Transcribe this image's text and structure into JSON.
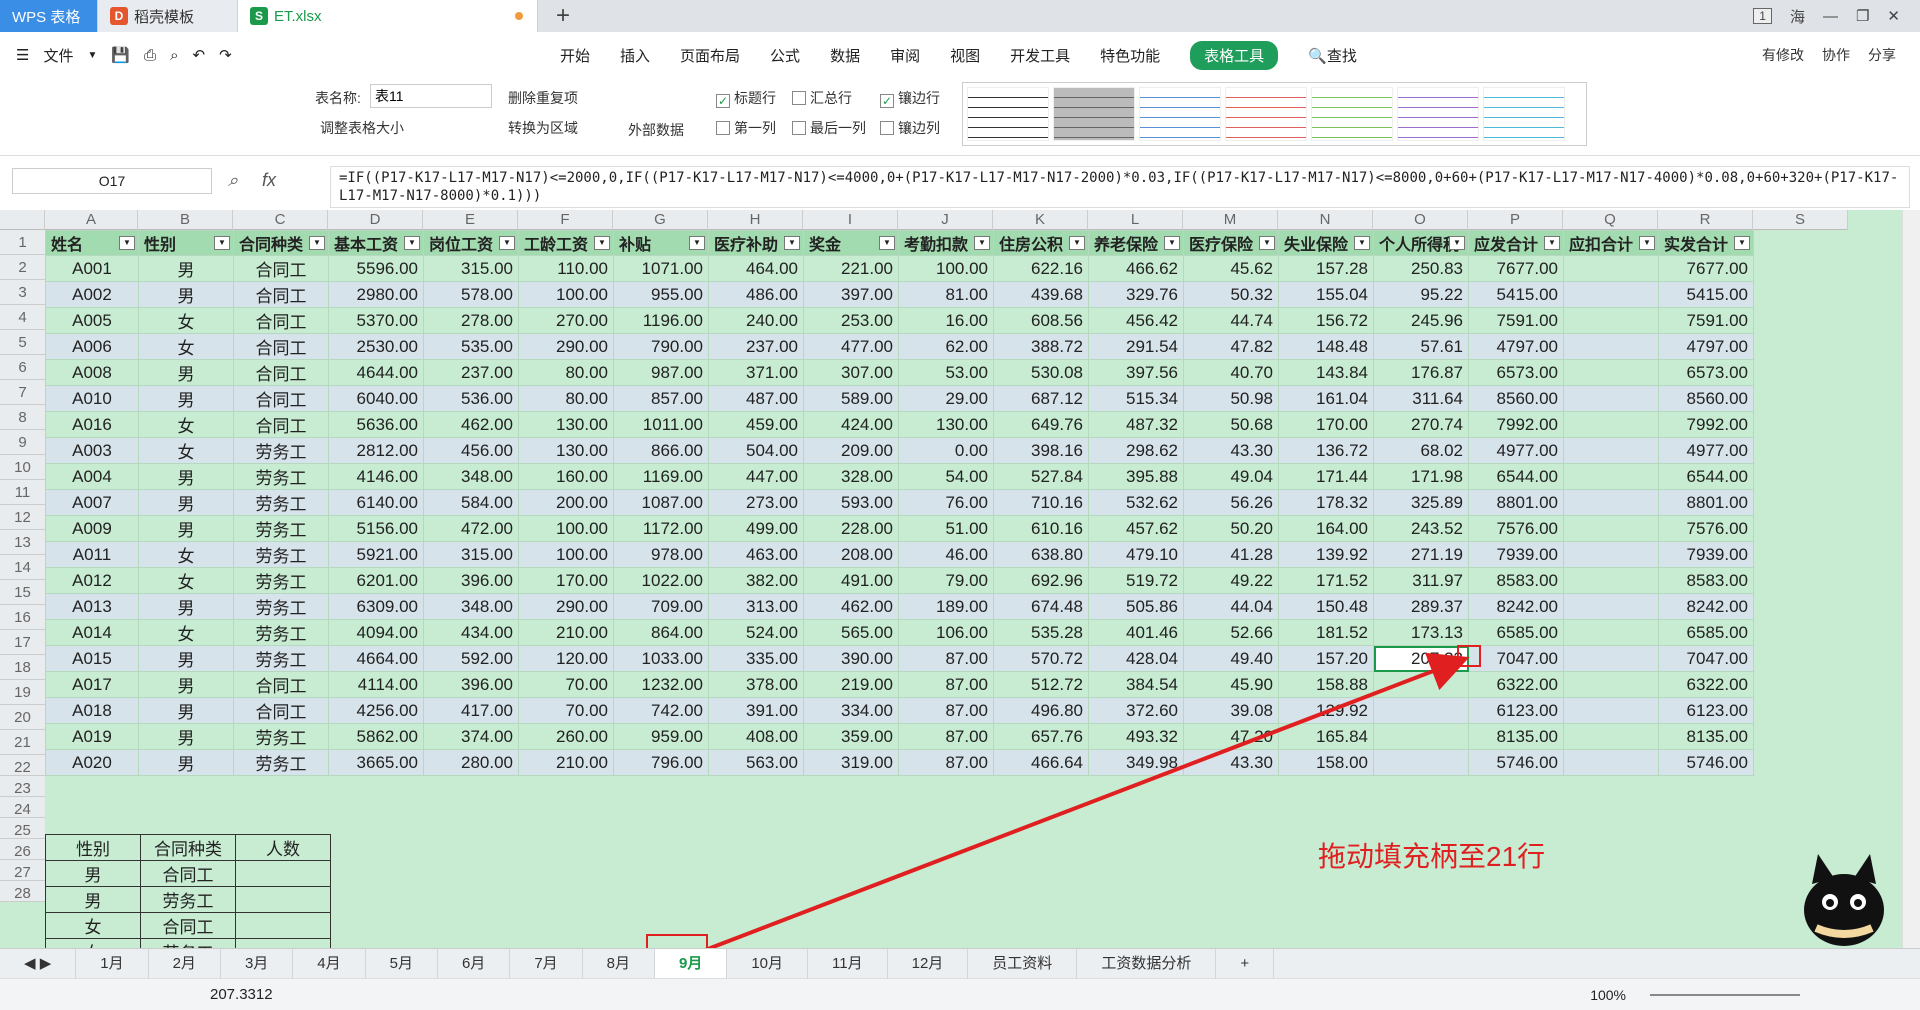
{
  "titlebar": {
    "tabs": [
      {
        "label": "WPS 表格"
      },
      {
        "label": "稻壳模板"
      },
      {
        "label": "ET.xlsx"
      }
    ],
    "badge": "1",
    "user": "海"
  },
  "menu": {
    "file": "文件",
    "items": [
      "开始",
      "插入",
      "页面布局",
      "公式",
      "数据",
      "审阅",
      "视图",
      "开发工具",
      "特色功能",
      "表格工具"
    ],
    "search": "查找",
    "right": [
      "有修改",
      "协作",
      "分享"
    ]
  },
  "toolbar": {
    "table_name_label": "表名称:",
    "table_name": "表11",
    "resize": "调整表格大小",
    "remove_dup": "删除重复项",
    "to_range": "转换为区域",
    "external": "外部数据",
    "checks": [
      {
        "label": "标题行",
        "checked": true
      },
      {
        "label": "汇总行",
        "checked": false
      },
      {
        "label": "镶边行",
        "checked": true
      },
      {
        "label": "第一列",
        "checked": false
      },
      {
        "label": "最后一列",
        "checked": false
      },
      {
        "label": "镶边列",
        "checked": false
      }
    ]
  },
  "formula": {
    "cell": "O17",
    "fx": "fx",
    "text": "=IF((P17-K17-L17-M17-N17)<=2000,0,IF((P17-K17-L17-M17-N17)<=4000,0+(P17-K17-L17-M17-N17-2000)*0.03,IF((P17-K17-L17-M17-N17)<=8000,0+60+(P17-K17-L17-M17-N17-4000)*0.08,0+60+320+(P17-K17-L17-M17-N17-8000)*0.1)))"
  },
  "columns": [
    "A",
    "B",
    "C",
    "D",
    "E",
    "F",
    "G",
    "H",
    "I",
    "J",
    "K",
    "L",
    "M",
    "N",
    "O",
    "P",
    "Q",
    "R",
    "S"
  ],
  "headers": [
    "姓名",
    "性别",
    "合同种类",
    "基本工资",
    "岗位工资",
    "工龄工资",
    "补贴",
    "医疗补助",
    "奖金",
    "考勤扣款",
    "住房公积",
    "养老保险",
    "医疗保险",
    "失业保险",
    "个人所得税",
    "应发合计",
    "应扣合计",
    "实发合计"
  ],
  "rows": [
    [
      "A001",
      "男",
      "合同工",
      "5596.00",
      "315.00",
      "110.00",
      "1071.00",
      "464.00",
      "221.00",
      "100.00",
      "622.16",
      "466.62",
      "45.62",
      "157.28",
      "250.83",
      "7677.00",
      "",
      "7677.00"
    ],
    [
      "A002",
      "男",
      "合同工",
      "2980.00",
      "578.00",
      "100.00",
      "955.00",
      "486.00",
      "397.00",
      "81.00",
      "439.68",
      "329.76",
      "50.32",
      "155.04",
      "95.22",
      "5415.00",
      "",
      "5415.00"
    ],
    [
      "A005",
      "女",
      "合同工",
      "5370.00",
      "278.00",
      "270.00",
      "1196.00",
      "240.00",
      "253.00",
      "16.00",
      "608.56",
      "456.42",
      "44.74",
      "156.72",
      "245.96",
      "7591.00",
      "",
      "7591.00"
    ],
    [
      "A006",
      "女",
      "合同工",
      "2530.00",
      "535.00",
      "290.00",
      "790.00",
      "237.00",
      "477.00",
      "62.00",
      "388.72",
      "291.54",
      "47.82",
      "148.48",
      "57.61",
      "4797.00",
      "",
      "4797.00"
    ],
    [
      "A008",
      "男",
      "合同工",
      "4644.00",
      "237.00",
      "80.00",
      "987.00",
      "371.00",
      "307.00",
      "53.00",
      "530.08",
      "397.56",
      "40.70",
      "143.84",
      "176.87",
      "6573.00",
      "",
      "6573.00"
    ],
    [
      "A010",
      "男",
      "合同工",
      "6040.00",
      "536.00",
      "80.00",
      "857.00",
      "487.00",
      "589.00",
      "29.00",
      "687.12",
      "515.34",
      "50.98",
      "161.04",
      "311.64",
      "8560.00",
      "",
      "8560.00"
    ],
    [
      "A016",
      "女",
      "合同工",
      "5636.00",
      "462.00",
      "130.00",
      "1011.00",
      "459.00",
      "424.00",
      "130.00",
      "649.76",
      "487.32",
      "50.68",
      "170.00",
      "270.74",
      "7992.00",
      "",
      "7992.00"
    ],
    [
      "A003",
      "女",
      "劳务工",
      "2812.00",
      "456.00",
      "130.00",
      "866.00",
      "504.00",
      "209.00",
      "0.00",
      "398.16",
      "298.62",
      "43.30",
      "136.72",
      "68.02",
      "4977.00",
      "",
      "4977.00"
    ],
    [
      "A004",
      "男",
      "劳务工",
      "4146.00",
      "348.00",
      "160.00",
      "1169.00",
      "447.00",
      "328.00",
      "54.00",
      "527.84",
      "395.88",
      "49.04",
      "171.44",
      "171.98",
      "6544.00",
      "",
      "6544.00"
    ],
    [
      "A007",
      "男",
      "劳务工",
      "6140.00",
      "584.00",
      "200.00",
      "1087.00",
      "273.00",
      "593.00",
      "76.00",
      "710.16",
      "532.62",
      "56.26",
      "178.32",
      "325.89",
      "8801.00",
      "",
      "8801.00"
    ],
    [
      "A009",
      "男",
      "劳务工",
      "5156.00",
      "472.00",
      "100.00",
      "1172.00",
      "499.00",
      "228.00",
      "51.00",
      "610.16",
      "457.62",
      "50.20",
      "164.00",
      "243.52",
      "7576.00",
      "",
      "7576.00"
    ],
    [
      "A011",
      "女",
      "劳务工",
      "5921.00",
      "315.00",
      "100.00",
      "978.00",
      "463.00",
      "208.00",
      "46.00",
      "638.80",
      "479.10",
      "41.28",
      "139.92",
      "271.19",
      "7939.00",
      "",
      "7939.00"
    ],
    [
      "A012",
      "女",
      "劳务工",
      "6201.00",
      "396.00",
      "170.00",
      "1022.00",
      "382.00",
      "491.00",
      "79.00",
      "692.96",
      "519.72",
      "49.22",
      "171.52",
      "311.97",
      "8583.00",
      "",
      "8583.00"
    ],
    [
      "A013",
      "男",
      "劳务工",
      "6309.00",
      "348.00",
      "290.00",
      "709.00",
      "313.00",
      "462.00",
      "189.00",
      "674.48",
      "505.86",
      "44.04",
      "150.48",
      "289.37",
      "8242.00",
      "",
      "8242.00"
    ],
    [
      "A014",
      "女",
      "劳务工",
      "4094.00",
      "434.00",
      "210.00",
      "864.00",
      "524.00",
      "565.00",
      "106.00",
      "535.28",
      "401.46",
      "52.66",
      "181.52",
      "173.13",
      "6585.00",
      "",
      "6585.00"
    ],
    [
      "A015",
      "男",
      "劳务工",
      "4664.00",
      "592.00",
      "120.00",
      "1033.00",
      "335.00",
      "390.00",
      "87.00",
      "570.72",
      "428.04",
      "49.40",
      "157.20",
      "207.33",
      "7047.00",
      "",
      "7047.00"
    ],
    [
      "A017",
      "男",
      "合同工",
      "4114.00",
      "396.00",
      "70.00",
      "1232.00",
      "378.00",
      "219.00",
      "87.00",
      "512.72",
      "384.54",
      "45.90",
      "158.88",
      "",
      "6322.00",
      "",
      "6322.00"
    ],
    [
      "A018",
      "男",
      "合同工",
      "4256.00",
      "417.00",
      "70.00",
      "742.00",
      "391.00",
      "334.00",
      "87.00",
      "496.80",
      "372.60",
      "39.08",
      "129.92",
      "",
      "6123.00",
      "",
      "6123.00"
    ],
    [
      "A019",
      "男",
      "劳务工",
      "5862.00",
      "374.00",
      "260.00",
      "959.00",
      "408.00",
      "359.00",
      "87.00",
      "657.76",
      "493.32",
      "47.20",
      "165.84",
      "",
      "8135.00",
      "",
      "8135.00"
    ],
    [
      "A020",
      "男",
      "劳务工",
      "3665.00",
      "280.00",
      "210.00",
      "796.00",
      "563.00",
      "319.00",
      "87.00",
      "466.64",
      "349.98",
      "43.30",
      "158.00",
      "",
      "5746.00",
      "",
      "5746.00"
    ]
  ],
  "summary": {
    "headers": [
      "性别",
      "合同种类",
      "人数"
    ],
    "rows": [
      [
        "男",
        "合同工",
        ""
      ],
      [
        "男",
        "劳务工",
        ""
      ],
      [
        "女",
        "合同工",
        ""
      ],
      [
        "女",
        "劳务工",
        ""
      ]
    ]
  },
  "annotation": "拖动填充柄至21行",
  "sheets": [
    "1月",
    "2月",
    "3月",
    "4月",
    "5月",
    "6月",
    "7月",
    "8月",
    "9月",
    "10月",
    "11月",
    "12月",
    "员工资料",
    "工资数据分析"
  ],
  "active_sheet": "9月",
  "status": {
    "value": "207.3312",
    "zoom": "100%"
  }
}
